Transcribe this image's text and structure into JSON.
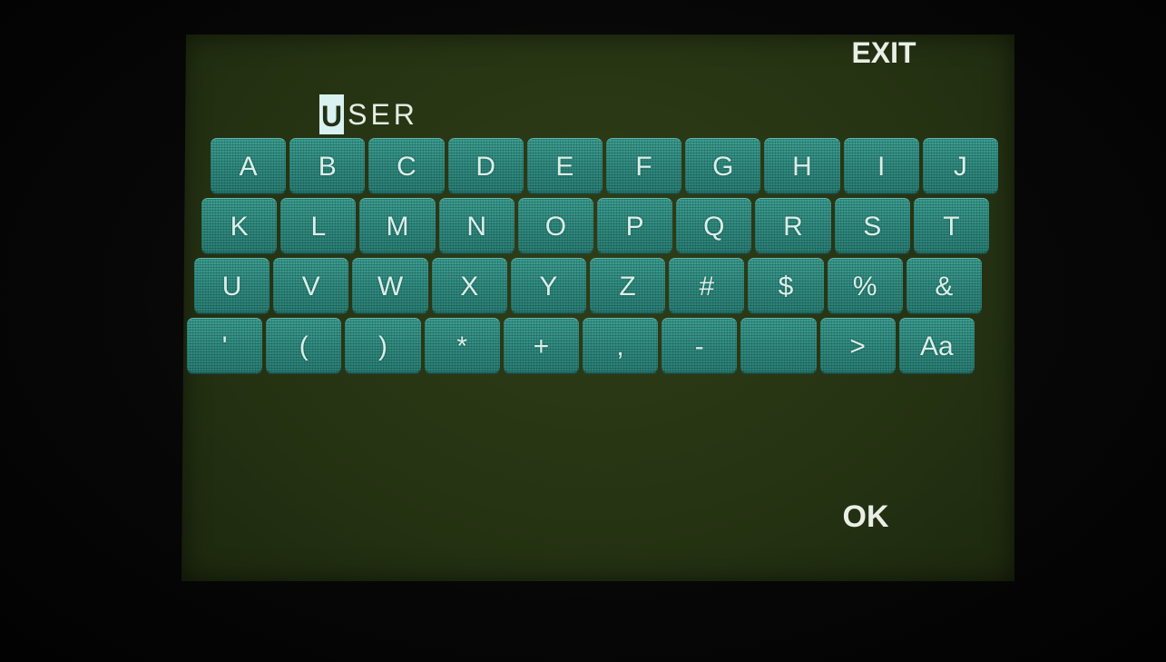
{
  "screen": {
    "exit_label": "EXIT",
    "ok_label": "OK"
  },
  "name_field": {
    "cursor_char": "U",
    "rest": "SER"
  },
  "keyboard": {
    "rows": [
      [
        "A",
        "B",
        "C",
        "D",
        "E",
        "F",
        "G",
        "H",
        "I",
        "J"
      ],
      [
        "K",
        "L",
        "M",
        "N",
        "O",
        "P",
        "Q",
        "R",
        "S",
        "T"
      ],
      [
        "U",
        "V",
        "W",
        "X",
        "Y",
        "Z",
        "#",
        "$",
        "%",
        "&"
      ],
      [
        "'",
        "(",
        ")",
        "*",
        "+",
        ",",
        "-",
        "",
        ">",
        "Aa"
      ]
    ]
  },
  "colors": {
    "screen_bg": "#263313",
    "key_bg": "#2f8b80",
    "text": "#e9efe6"
  }
}
